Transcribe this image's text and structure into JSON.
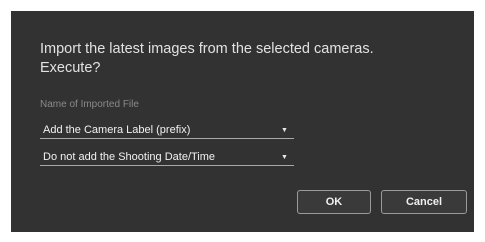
{
  "dialog": {
    "message_line1": "Import the latest images from the selected cameras.",
    "message_line2": "Execute?",
    "field_label": "Name of Imported File",
    "prefix_select": {
      "value": "Add the Camera Label (prefix)"
    },
    "date_select": {
      "value": "Do not add the Shooting Date/Time"
    },
    "ok_label": "OK",
    "cancel_label": "Cancel"
  },
  "icons": {
    "dropdown_arrow": "triangle-down-icon"
  },
  "colors": {
    "dialog_background": "#323232",
    "text": "#e2e2e2",
    "label": "#8a8a8a"
  }
}
